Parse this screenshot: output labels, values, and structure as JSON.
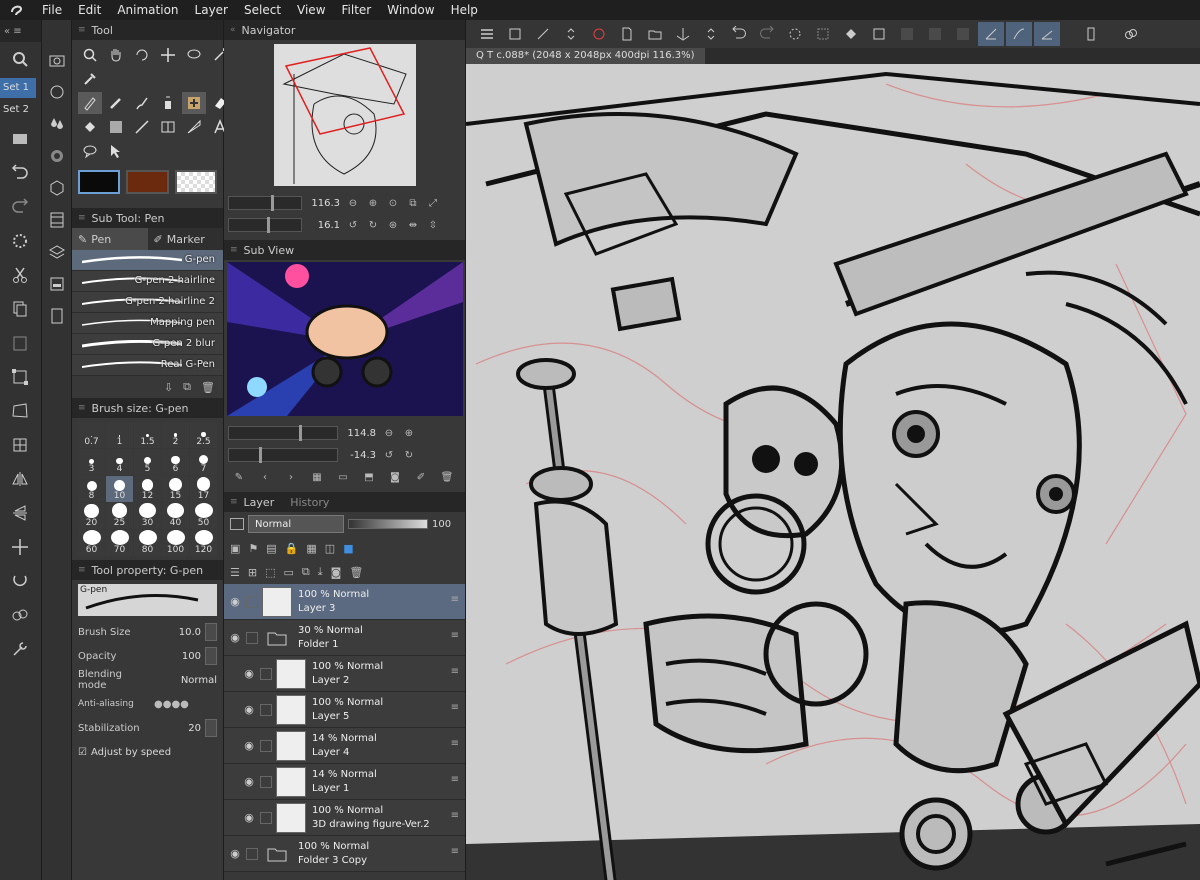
{
  "menu": [
    "File",
    "Edit",
    "Animation",
    "Layer",
    "Select",
    "View",
    "Filter",
    "Window",
    "Help"
  ],
  "sets": [
    "Set 1",
    "Set 2"
  ],
  "panels": {
    "tool": "Tool",
    "subtool": "Sub Tool: Pen",
    "brushsize": "Brush size: G-pen",
    "toolprop": "Tool property: G-pen",
    "navigator": "Navigator",
    "subview": "Sub View",
    "layer": "Layer",
    "history": "History"
  },
  "subtool_tabs": [
    "Pen",
    "Marker"
  ],
  "brushes": [
    "G-pen",
    "G-pen 2 hairline",
    "G-pen 2 hairline 2",
    "Mapping pen",
    "G-pen 2 blur",
    "Real G-Pen"
  ],
  "brush_sizes": [
    "0.7",
    "1",
    "1.5",
    "2",
    "2.5",
    "3",
    "4",
    "5",
    "6",
    "7",
    "8",
    "10",
    "12",
    "15",
    "17",
    "20",
    "25",
    "30",
    "40",
    "50",
    "60",
    "70",
    "80",
    "100",
    "120"
  ],
  "selected_size": "10",
  "colors": {
    "main": "#0a0a0a",
    "sub": "#6b2a0e",
    "accent": "#3e6fa8"
  },
  "toolprop": {
    "brush_name": "G-pen",
    "brush_size_label": "Brush Size",
    "brush_size_value": "10.0",
    "opacity_label": "Opacity",
    "opacity_value": "100",
    "blending_label": "Blending mode",
    "blending_value": "Normal",
    "antialias_label": "Anti-aliasing",
    "stabilization_label": "Stabilization",
    "stabilization_value": "20",
    "adjust_label": "Adjust by speed"
  },
  "navigator": {
    "zoom": "116.3",
    "rotate": "16.1"
  },
  "subview_ctrl": {
    "zoom": "114.8",
    "rotate": "-14.3"
  },
  "layer_blend": "Normal",
  "layer_opacity": "100",
  "layers": [
    {
      "mode": "100 % Normal",
      "name": "Layer 3",
      "selected": true,
      "folder": false,
      "indent": 0
    },
    {
      "mode": "30 % Normal",
      "name": "Folder 1",
      "selected": false,
      "folder": true,
      "indent": 0
    },
    {
      "mode": "100 % Normal",
      "name": "Layer 2",
      "selected": false,
      "folder": false,
      "indent": 1
    },
    {
      "mode": "100 % Normal",
      "name": "Layer 5",
      "selected": false,
      "folder": false,
      "indent": 1
    },
    {
      "mode": "14 % Normal",
      "name": "Layer 4",
      "selected": false,
      "folder": false,
      "indent": 1
    },
    {
      "mode": "14 % Normal",
      "name": "Layer 1",
      "selected": false,
      "folder": false,
      "indent": 1
    },
    {
      "mode": "100 % Normal",
      "name": "3D drawing figure-Ver.2",
      "selected": false,
      "folder": false,
      "indent": 1
    },
    {
      "mode": "100 % Normal",
      "name": "Folder 3 Copy",
      "selected": false,
      "folder": true,
      "indent": 0
    }
  ],
  "canvas_tab": "Q T c.088* (2048 x 2048px 400dpi 116.3%)"
}
